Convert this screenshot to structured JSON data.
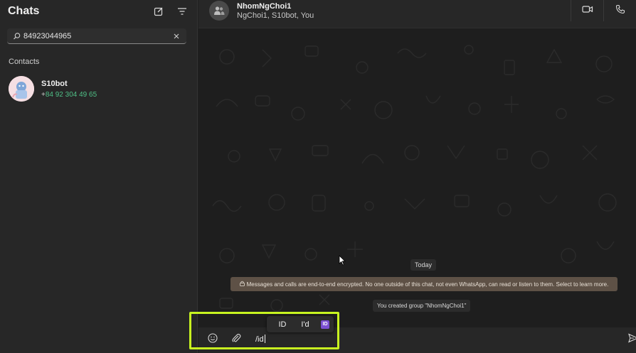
{
  "sidebar": {
    "title": "Chats",
    "new_chat_icon": "compose-icon",
    "filter_icon": "filter-icon",
    "search": {
      "value": "84923044965",
      "icon": "search-icon",
      "clear_icon": "close-icon"
    },
    "section_label": "Contacts",
    "contacts": [
      {
        "name": "S10bot",
        "phone_plus": "+",
        "phone": "84 92 304 49 65"
      }
    ]
  },
  "chat_header": {
    "group_name": "NhomNgChoi1",
    "members": "NgChoi1, S10bot, You",
    "video_icon": "video-call-icon",
    "phone_icon": "voice-call-icon"
  },
  "chat": {
    "date_chip": "Today",
    "encryption_notice": "Messages and calls are end-to-end encrypted. No one outside of this chat, not even WhatsApp, can read or listen to them. Select to learn more.",
    "system_message": "You created group \"NhomNgChoi1\""
  },
  "composer": {
    "input_value": "/id",
    "emoji_icon": "emoji-icon",
    "attach_icon": "paperclip-icon",
    "send_icon": "send-icon"
  },
  "suggestions": {
    "items": [
      "ID",
      "I'd"
    ],
    "badge": "ID"
  },
  "colors": {
    "highlight": "#c8f520",
    "phone_green": "#4fbf86",
    "encryption_bg": "#5e5146"
  }
}
